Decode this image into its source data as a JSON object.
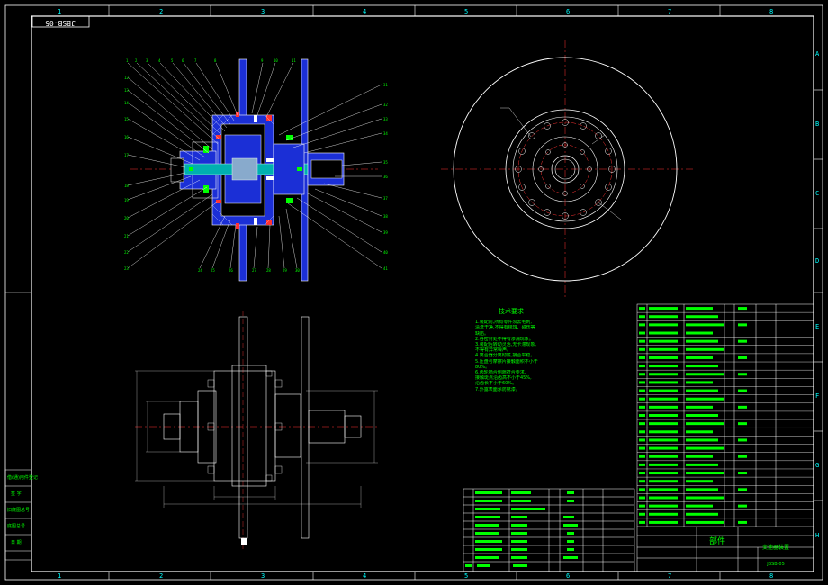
{
  "drawing_number": "JBSB-05",
  "col_labels": [
    "1",
    "2",
    "3",
    "4",
    "5",
    "6",
    "7",
    "8"
  ],
  "row_labels": [
    "A",
    "B",
    "C",
    "D",
    "E",
    "F",
    "G",
    "H"
  ],
  "tech_requirements": {
    "title": "技术要求",
    "lines": [
      "1.装配前,所有零件须去毛刺,",
      "清洗干净,不得有锈蚀、碰伤等",
      "缺陷。",
      "2.各密封处不得有渗漏现象。",
      "3.装配后转动灵活,无卡滞现象,",
      "不得有异常噪声。",
      "4.离合器分离彻底,接合平稳。",
      "5.压盘与摩擦片接触面积不小于",
      "80%。",
      "6.齿轮啮合侧隙符合要求,",
      "接触斑点沿齿高不小于45%,",
      "沿齿长不小于60%。",
      "7.外露表面涂防锈漆。"
    ]
  },
  "title_block": {
    "name": "部件",
    "assembly_name": "变速器装置",
    "code": "JBSB-05"
  },
  "side_labels": [
    "借(通)用件登记",
    "旧底图总号",
    "底图总号",
    "签 字",
    "日 期"
  ]
}
